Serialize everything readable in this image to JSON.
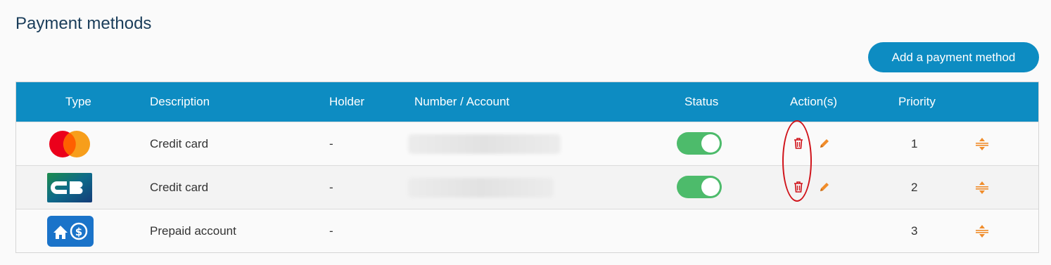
{
  "page": {
    "title": "Payment methods"
  },
  "toolbar": {
    "add_label": "Add a payment method"
  },
  "table": {
    "headers": {
      "type": "Type",
      "description": "Description",
      "holder": "Holder",
      "number": "Number / Account",
      "status": "Status",
      "actions": "Action(s)",
      "priority": "Priority"
    },
    "rows": [
      {
        "type_icon": "mastercard-logo-icon",
        "description": "Credit card",
        "holder": "-",
        "status_on": true,
        "priority": "1"
      },
      {
        "type_icon": "cb-logo-icon",
        "description": "Credit card",
        "holder": "-",
        "status_on": true,
        "priority": "2"
      },
      {
        "type_icon": "prepaid-account-icon",
        "description": "Prepaid account",
        "holder": "-",
        "status_on": null,
        "priority": "3"
      }
    ]
  },
  "colors": {
    "header_bg": "#0d8cc2",
    "title": "#1a3d5a",
    "toggle_on": "#4dbb6b",
    "delete": "#d0131a",
    "edit_and_reorder": "#f08c2a"
  }
}
